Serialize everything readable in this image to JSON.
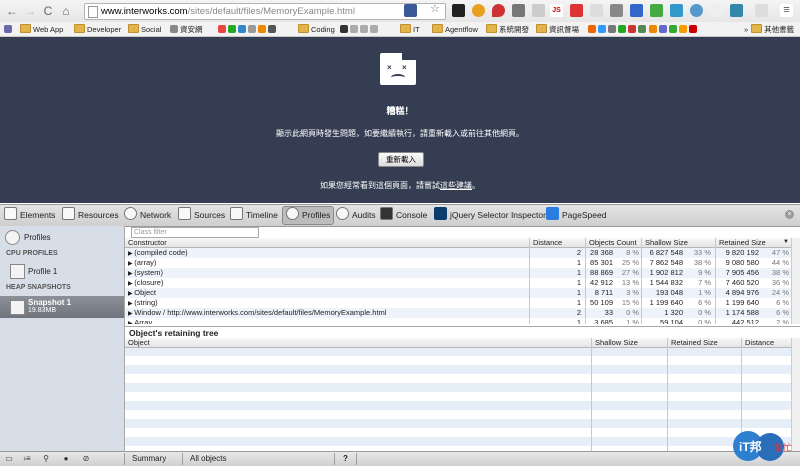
{
  "browser": {
    "url_prefix": "www.interworks.com",
    "url_path": "/sites/default/files/MemoryExample.html"
  },
  "bookmarks": [
    {
      "label": "Web App",
      "kind": "folder"
    },
    {
      "label": "Developer",
      "kind": "folder"
    },
    {
      "label": "Social",
      "kind": "folder"
    },
    {
      "label": "資安網",
      "kind": "site"
    },
    {
      "label": "Coding",
      "kind": "folder"
    },
    {
      "label": "IT",
      "kind": "folder"
    },
    {
      "label": "Agentflow",
      "kind": "folder"
    },
    {
      "label": "系統開發",
      "kind": "folder"
    },
    {
      "label": "資訊督場",
      "kind": "folder"
    },
    {
      "label": "其他書籤",
      "kind": "folder"
    }
  ],
  "crash": {
    "title": "糟糕！",
    "message": "顯示此網頁時發生問題，如要繼續執行，請重新載入或前往其他網頁。",
    "reload_label": "重新載入",
    "footer_prefix": "如果您經常看到這個頁面，請嘗試",
    "footer_link": "這些建議",
    "footer_suffix": "。"
  },
  "devtools": {
    "tabs": [
      {
        "label": "Elements",
        "icon": "elements-icon"
      },
      {
        "label": "Resources",
        "icon": "resources-icon"
      },
      {
        "label": "Network",
        "icon": "network-icon"
      },
      {
        "label": "Sources",
        "icon": "sources-icon"
      },
      {
        "label": "Timeline",
        "icon": "timeline-icon"
      },
      {
        "label": "Profiles",
        "icon": "profiles-icon",
        "active": true
      },
      {
        "label": "Audits",
        "icon": "audits-icon"
      },
      {
        "label": "Console",
        "icon": "console-icon"
      },
      {
        "label": "jQuery Selector Inspector",
        "icon": "jquery-icon"
      },
      {
        "label": "PageSpeed",
        "icon": "pagespeed-icon"
      }
    ]
  },
  "sidebar": {
    "profiles_label": "Profiles",
    "cpu_heading": "CPU PROFILES",
    "cpu_item": "Profile 1",
    "heap_heading": "HEAP SNAPSHOTS",
    "snapshot_name": "Snapshot 1",
    "snapshot_size": "19.83MB"
  },
  "summary": {
    "filter_placeholder": "Class filter",
    "columns": {
      "constructor": "Constructor",
      "distance": "Distance",
      "objects_count": "Objects Count",
      "shallow_size": "Shallow Size",
      "retained_size": "Retained Size"
    },
    "rows": [
      {
        "name": "(compiled code)",
        "distance": "2",
        "count": "28 368",
        "count_pct": "8 %",
        "shallow": "6 827 548",
        "shallow_pct": "33 %",
        "retained": "9 820 192",
        "retained_pct": "47 %"
      },
      {
        "name": "(array)",
        "distance": "1",
        "count": "85 301",
        "count_pct": "25 %",
        "shallow": "7 862 548",
        "shallow_pct": "38 %",
        "retained": "9 080 580",
        "retained_pct": "44 %"
      },
      {
        "name": "(system)",
        "distance": "1",
        "count": "88 869",
        "count_pct": "27 %",
        "shallow": "1 902 812",
        "shallow_pct": "9 %",
        "retained": "7 905 456",
        "retained_pct": "38 %"
      },
      {
        "name": "(closure)",
        "distance": "1",
        "count": "42 912",
        "count_pct": "13 %",
        "shallow": "1 544 832",
        "shallow_pct": "7 %",
        "retained": "7 460 520",
        "retained_pct": "36 %"
      },
      {
        "name": "Object",
        "distance": "1",
        "count": "8 711",
        "count_pct": "3 %",
        "shallow": "193 048",
        "shallow_pct": "1 %",
        "retained": "4 894 976",
        "retained_pct": "24 %"
      },
      {
        "name": "(string)",
        "distance": "1",
        "count": "50 109",
        "count_pct": "15 %",
        "shallow": "1 199 640",
        "shallow_pct": "6 %",
        "retained": "1 199 640",
        "retained_pct": "6 %"
      },
      {
        "name": "Window / http://www.interworks.com/sites/default/files/MemoryExample.html",
        "distance": "2",
        "count": "33",
        "count_pct": "0 %",
        "shallow": "1 320",
        "shallow_pct": "0 %",
        "retained": "1 174 588",
        "retained_pct": "6 %"
      },
      {
        "name": "Array",
        "distance": "1",
        "count": "3 685",
        "count_pct": "1 %",
        "shallow": "59 104",
        "shallow_pct": "0 %",
        "retained": "442 512",
        "retained_pct": "2 %"
      }
    ]
  },
  "retaining": {
    "title": "Object's retaining tree",
    "columns": {
      "object": "Object",
      "shallow_size": "Shallow Size",
      "retained_size": "Retained Size",
      "distance": "Distance"
    }
  },
  "status": {
    "view": "Summary",
    "filter": "All objects",
    "help": "?"
  },
  "logo": {
    "text": "iT邦",
    "sub": "幫忙"
  }
}
